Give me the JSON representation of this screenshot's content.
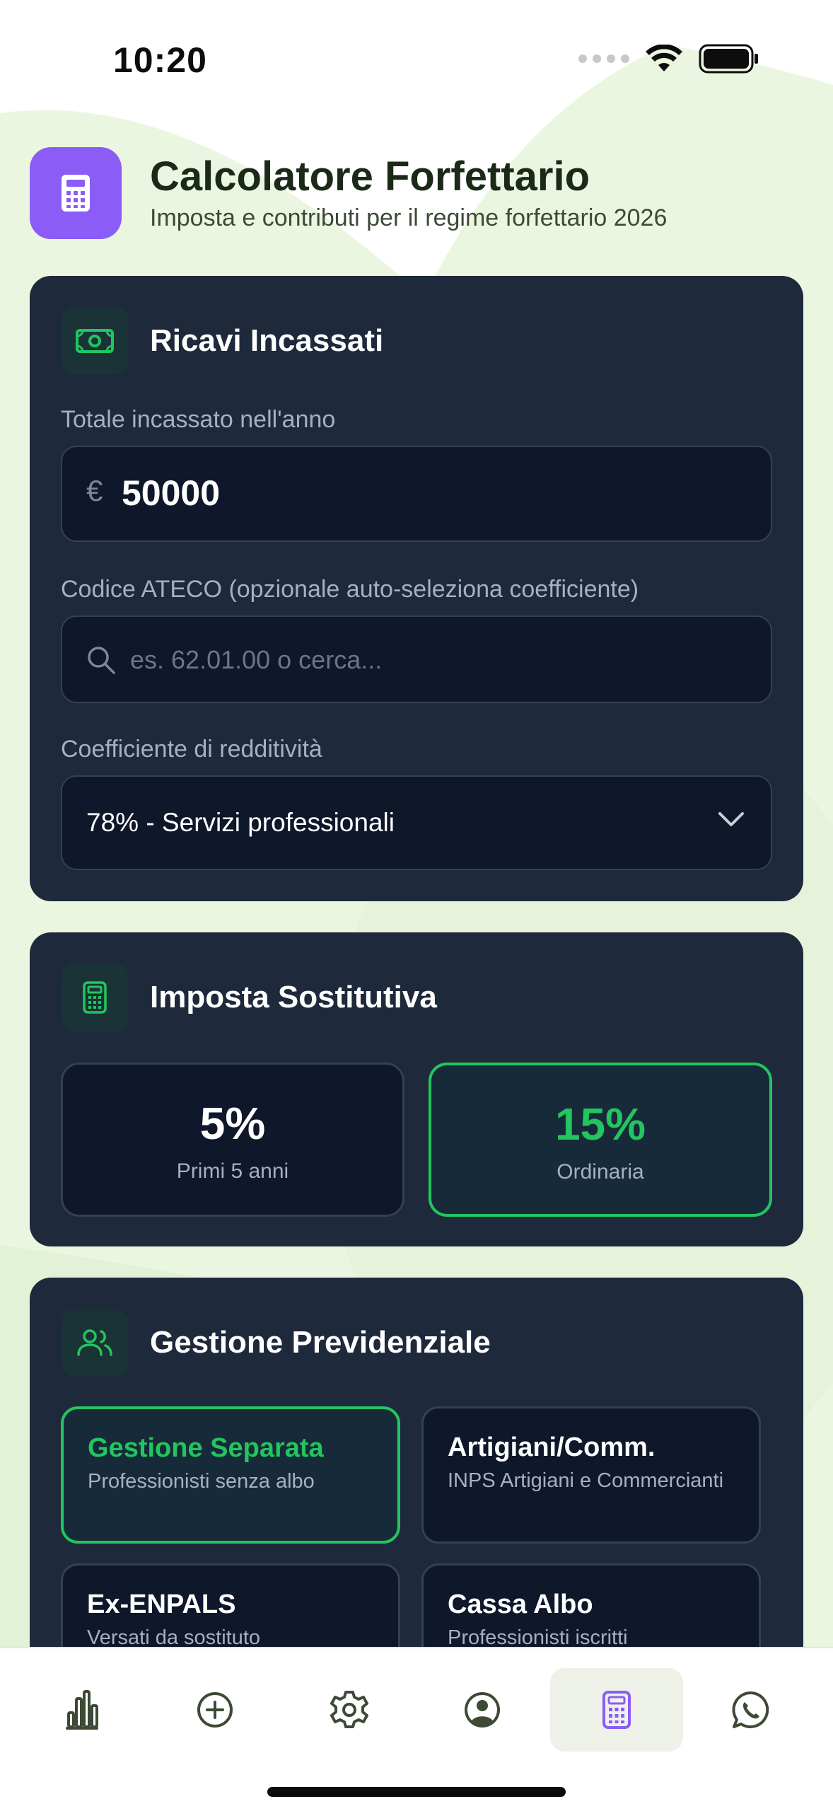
{
  "status_bar": {
    "time": "10:20"
  },
  "header": {
    "title": "Calcolatore Forfettario",
    "subtitle": "Imposta e contributi per il regime forfettario 2026",
    "logo_icon": "calculator-icon"
  },
  "revenue_card": {
    "title": "Ricavi Incassati",
    "icon": "banknote-icon",
    "total_label": "Totale incassato nell'anno",
    "currency": "€",
    "total_value": "50000",
    "ateco_label": "Codice ATECO (opzionale auto-seleziona coefficiente)",
    "ateco_placeholder": "es. 62.01.00 o cerca...",
    "coefficient_label": "Coefficiente di redditività",
    "coefficient_value": "78% - Servizi professionali"
  },
  "tax_card": {
    "title": "Imposta Sostitutiva",
    "icon": "calculator-icon",
    "options": [
      {
        "value": "5%",
        "description": "Primi 5 anni",
        "selected": false
      },
      {
        "value": "15%",
        "description": "Ordinaria",
        "selected": true
      }
    ]
  },
  "pension_card": {
    "title": "Gestione Previdenziale",
    "icon": "users-icon",
    "options": [
      {
        "title": "Gestione Separata",
        "description": "Professionisti senza albo",
        "selected": true
      },
      {
        "title": "Artigiani/Comm.",
        "description": "INPS Artigiani e Commercianti",
        "selected": false
      },
      {
        "title": "Ex-ENPALS",
        "description": "Versati da sostituto",
        "selected": false
      },
      {
        "title": "Cassa Albo",
        "description": "Professionisti iscritti",
        "selected": false
      }
    ]
  },
  "bottom_nav": {
    "items": [
      {
        "icon": "bar-chart-icon",
        "active": false
      },
      {
        "icon": "plus-circle-icon",
        "active": false
      },
      {
        "icon": "gear-icon",
        "active": false
      },
      {
        "icon": "user-circle-icon",
        "active": false
      },
      {
        "icon": "calculator-icon",
        "active": true
      },
      {
        "icon": "whatsapp-icon",
        "active": false
      }
    ]
  },
  "colors": {
    "accent_green": "#22c55e",
    "accent_purple": "#8b5cf6",
    "card_bg": "#1e293b",
    "field_bg": "#0f172a",
    "background_blob": "#e8f5dc"
  }
}
